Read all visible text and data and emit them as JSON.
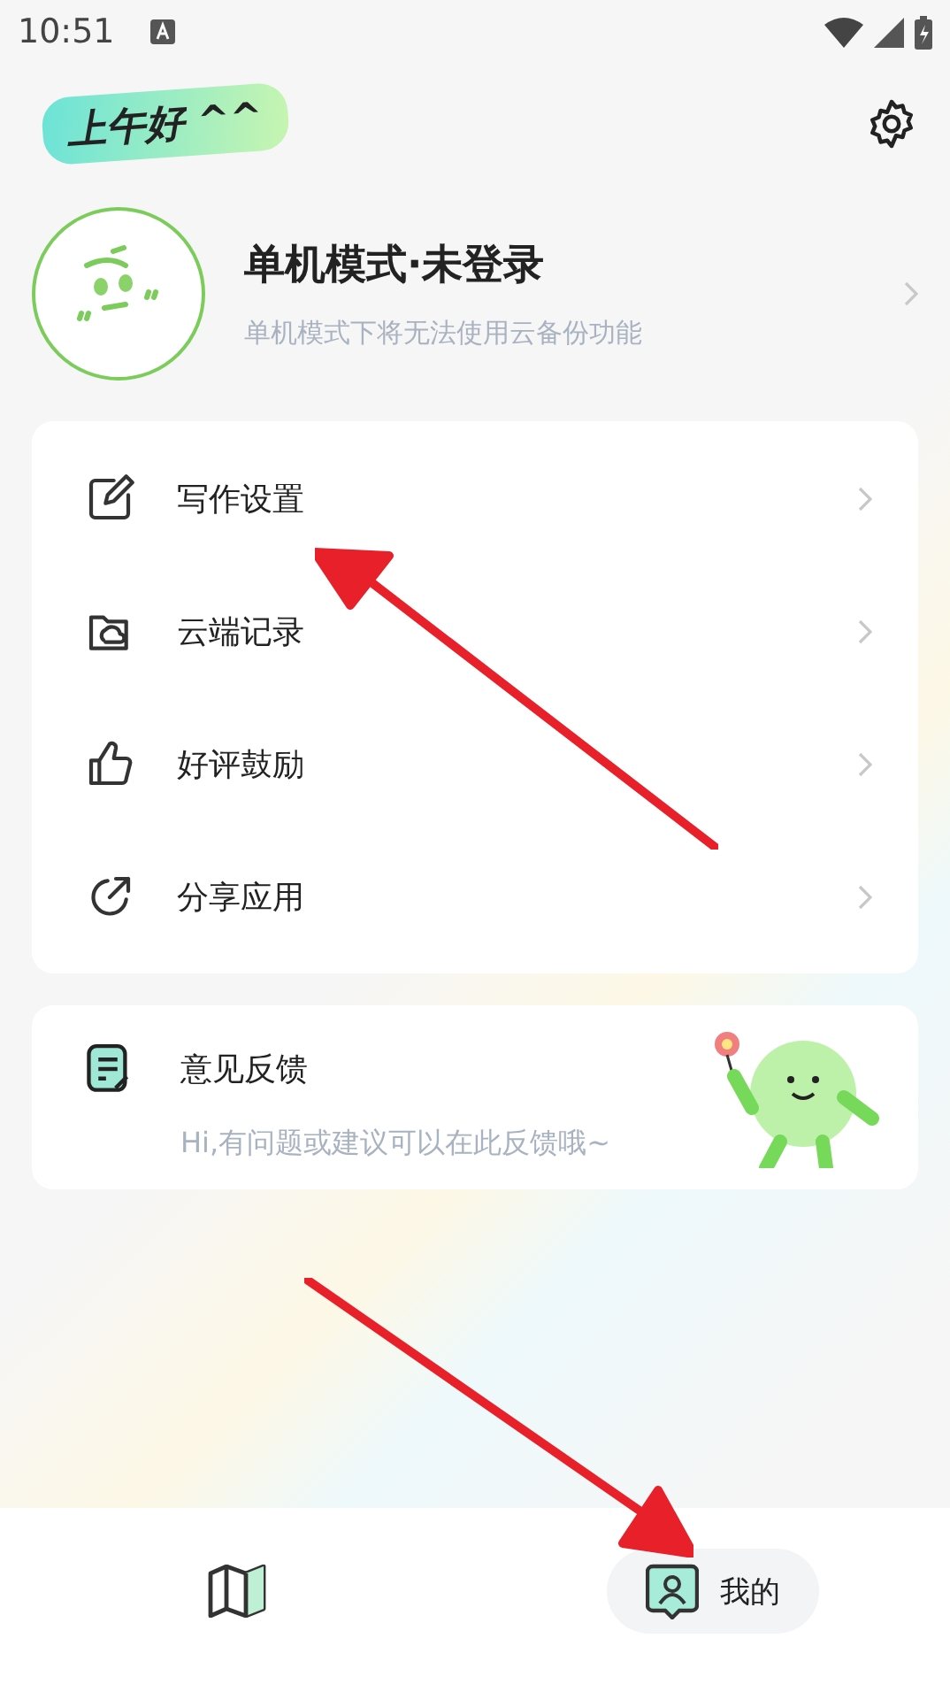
{
  "status_bar": {
    "time": "10:51"
  },
  "greeting": "上午好 ^^",
  "profile": {
    "name": "单机模式·未登录",
    "subtitle": "单机模式下将无法使用云备份功能"
  },
  "menu": [
    {
      "kind": "edit",
      "label": "写作设置"
    },
    {
      "kind": "cloud",
      "label": "云端记录"
    },
    {
      "kind": "thumb",
      "label": "好评鼓励"
    },
    {
      "kind": "share",
      "label": "分享应用"
    }
  ],
  "feedback": {
    "title": "意见反馈",
    "subtitle": "Hi,有问题或建议可以在此反馈哦~"
  },
  "nav": [
    {
      "kind": "map",
      "selected": false
    },
    {
      "kind": "me",
      "label": "我的",
      "selected": true
    }
  ]
}
